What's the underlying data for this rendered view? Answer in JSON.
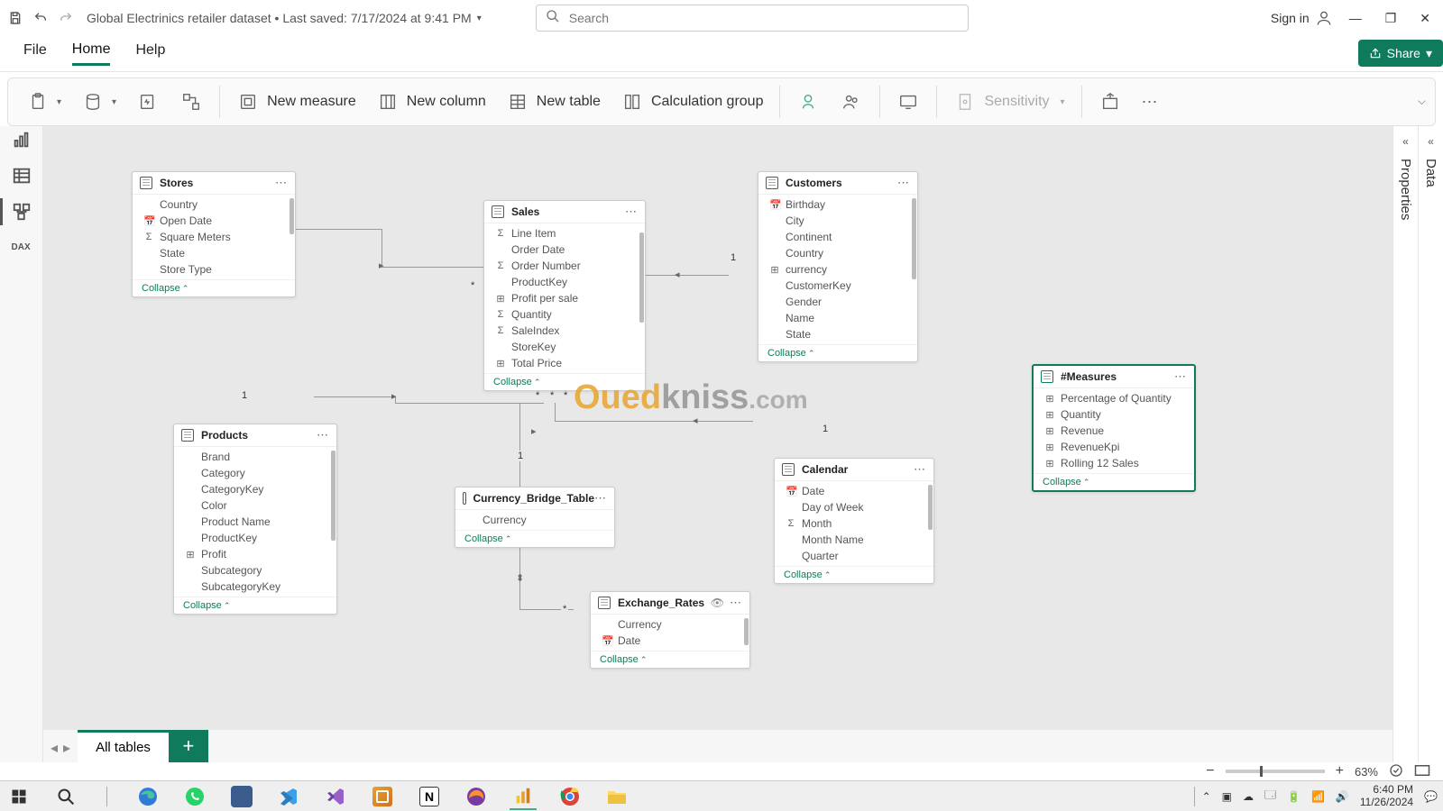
{
  "titlebar": {
    "title": "Global Electrinics retailer dataset • Last saved: 7/17/2024 at 9:41 PM",
    "search_placeholder": "Search",
    "signin": "Sign in"
  },
  "menu": {
    "file": "File",
    "home": "Home",
    "help": "Help",
    "share": "Share"
  },
  "ribbon": {
    "new_measure": "New measure",
    "new_column": "New column",
    "new_table": "New table",
    "calc_group": "Calculation group",
    "sensitivity": "Sensitivity"
  },
  "right_panels": {
    "properties": "Properties",
    "data": "Data"
  },
  "tabs": {
    "all_tables": "All tables"
  },
  "status": {
    "zoom": "63%"
  },
  "collapse": "Collapse",
  "tables": {
    "stores": {
      "name": "Stores",
      "fields": [
        {
          "label": "Country",
          "icon": ""
        },
        {
          "label": "Open Date",
          "icon": "📅"
        },
        {
          "label": "Square Meters",
          "icon": "Σ"
        },
        {
          "label": "State",
          "icon": ""
        },
        {
          "label": "Store Type",
          "icon": ""
        }
      ]
    },
    "sales": {
      "name": "Sales",
      "fields": [
        {
          "label": "Line Item",
          "icon": "Σ"
        },
        {
          "label": "Order Date",
          "icon": ""
        },
        {
          "label": "Order Number",
          "icon": "Σ"
        },
        {
          "label": "ProductKey",
          "icon": ""
        },
        {
          "label": "Profit per sale",
          "icon": "⊞"
        },
        {
          "label": "Quantity",
          "icon": "Σ"
        },
        {
          "label": "SaleIndex",
          "icon": "Σ"
        },
        {
          "label": "StoreKey",
          "icon": ""
        },
        {
          "label": "Total Price",
          "icon": "⊞"
        }
      ]
    },
    "customers": {
      "name": "Customers",
      "fields": [
        {
          "label": "Birthday",
          "icon": "📅"
        },
        {
          "label": "City",
          "icon": ""
        },
        {
          "label": "Continent",
          "icon": ""
        },
        {
          "label": "Country",
          "icon": ""
        },
        {
          "label": "currency",
          "icon": "⊞"
        },
        {
          "label": "CustomerKey",
          "icon": ""
        },
        {
          "label": "Gender",
          "icon": ""
        },
        {
          "label": "Name",
          "icon": ""
        },
        {
          "label": "State",
          "icon": ""
        }
      ]
    },
    "products": {
      "name": "Products",
      "fields": [
        {
          "label": "Brand",
          "icon": ""
        },
        {
          "label": "Category",
          "icon": ""
        },
        {
          "label": "CategoryKey",
          "icon": ""
        },
        {
          "label": "Color",
          "icon": ""
        },
        {
          "label": "Product Name",
          "icon": ""
        },
        {
          "label": "ProductKey",
          "icon": ""
        },
        {
          "label": "Profit",
          "icon": "⊞"
        },
        {
          "label": "Subcategory",
          "icon": ""
        },
        {
          "label": "SubcategoryKey",
          "icon": ""
        }
      ]
    },
    "currency_bridge": {
      "name": "Currency_Bridge_Table",
      "fields": [
        {
          "label": "Currency",
          "icon": ""
        }
      ]
    },
    "calendar": {
      "name": "Calendar",
      "fields": [
        {
          "label": "Date",
          "icon": "📅"
        },
        {
          "label": "Day of Week",
          "icon": ""
        },
        {
          "label": "Month",
          "icon": "Σ"
        },
        {
          "label": "Month Name",
          "icon": ""
        },
        {
          "label": "Quarter",
          "icon": ""
        }
      ]
    },
    "exchange": {
      "name": "Exchange_Rates",
      "fields": [
        {
          "label": "Currency",
          "icon": ""
        },
        {
          "label": "Date",
          "icon": "📅"
        }
      ]
    },
    "measures": {
      "name": "#Measures",
      "fields": [
        {
          "label": "Percentage of Quantity",
          "icon": "⊞"
        },
        {
          "label": "Quantity",
          "icon": "⊞"
        },
        {
          "label": "Revenue",
          "icon": "⊞"
        },
        {
          "label": "RevenueKpi",
          "icon": "⊞"
        },
        {
          "label": "Rolling 12 Sales",
          "icon": "⊞"
        }
      ]
    }
  },
  "system": {
    "time": "6:40 PM",
    "date": "11/26/2024"
  },
  "watermark": {
    "a": "Oued",
    "b": "kniss",
    "c": ".com"
  }
}
